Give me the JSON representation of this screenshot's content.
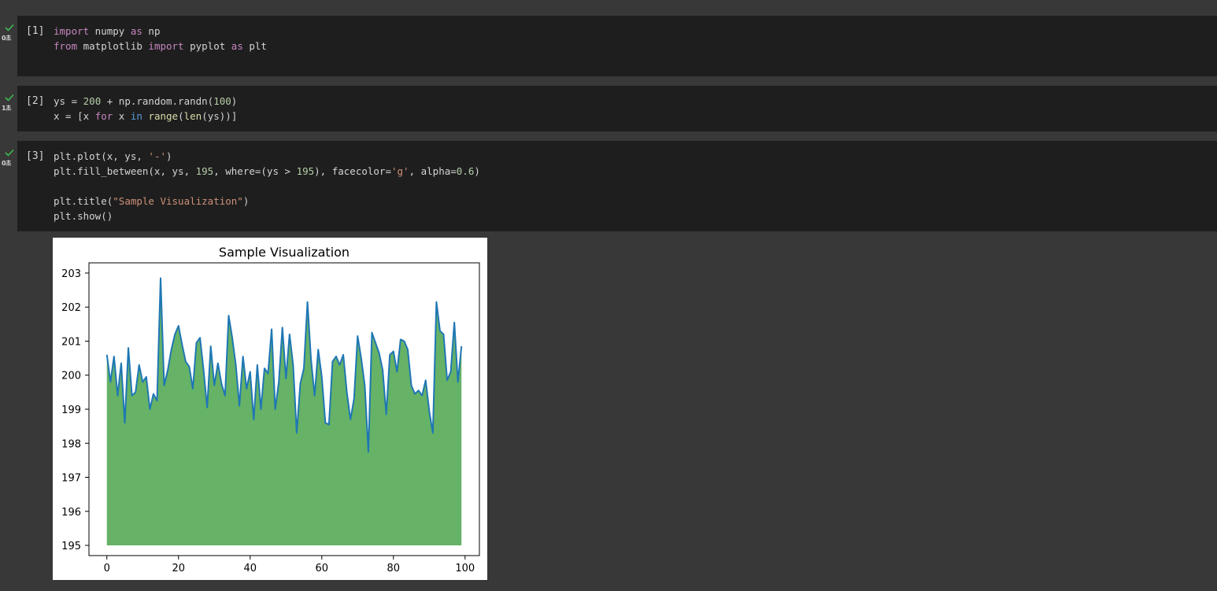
{
  "cells": [
    {
      "exec_label": "[1]",
      "status_time": "0초",
      "code_lines": [
        [
          {
            "t": "import",
            "c": "kw"
          },
          {
            "t": " numpy ",
            "c": ""
          },
          {
            "t": "as",
            "c": "kw"
          },
          {
            "t": " np",
            "c": ""
          }
        ],
        [
          {
            "t": "from",
            "c": "kw"
          },
          {
            "t": " matplotlib ",
            "c": ""
          },
          {
            "t": "import",
            "c": "kw"
          },
          {
            "t": " pyplot ",
            "c": ""
          },
          {
            "t": "as",
            "c": "kw"
          },
          {
            "t": " plt",
            "c": ""
          }
        ]
      ]
    },
    {
      "exec_label": "[2]",
      "status_time": "1초",
      "code_lines": [
        [
          {
            "t": "ys = ",
            "c": ""
          },
          {
            "t": "200",
            "c": "num"
          },
          {
            "t": " + np.random.randn(",
            "c": ""
          },
          {
            "t": "100",
            "c": "num"
          },
          {
            "t": ")",
            "c": ""
          }
        ],
        [
          {
            "t": "x = [x ",
            "c": ""
          },
          {
            "t": "for",
            "c": "kw"
          },
          {
            "t": " x ",
            "c": ""
          },
          {
            "t": "in",
            "c": "bi"
          },
          {
            "t": " ",
            "c": ""
          },
          {
            "t": "range",
            "c": "fn"
          },
          {
            "t": "(",
            "c": ""
          },
          {
            "t": "len",
            "c": "fn"
          },
          {
            "t": "(ys))]",
            "c": ""
          }
        ]
      ]
    },
    {
      "exec_label": "[3]",
      "status_time": "0초",
      "code_lines": [
        [
          {
            "t": "plt.plot(x, ys, ",
            "c": ""
          },
          {
            "t": "'-'",
            "c": "str"
          },
          {
            "t": ")",
            "c": ""
          }
        ],
        [
          {
            "t": "plt.fill_between(x, ys, ",
            "c": ""
          },
          {
            "t": "195",
            "c": "num"
          },
          {
            "t": ", where=(ys > ",
            "c": ""
          },
          {
            "t": "195",
            "c": "num"
          },
          {
            "t": "), facecolor=",
            "c": ""
          },
          {
            "t": "'g'",
            "c": "str"
          },
          {
            "t": ", alpha=",
            "c": ""
          },
          {
            "t": "0.6",
            "c": "num"
          },
          {
            "t": ")",
            "c": ""
          }
        ],
        [],
        [
          {
            "t": "plt.title(",
            "c": ""
          },
          {
            "t": "\"Sample Visualization\"",
            "c": "str"
          },
          {
            "t": ")",
            "c": ""
          }
        ],
        [
          {
            "t": "plt.show()",
            "c": ""
          }
        ]
      ]
    }
  ],
  "colors": {
    "line": "#1f77b4",
    "fill": "#66b266",
    "check": "#3fb950"
  },
  "chart_data": {
    "type": "area",
    "title": "Sample Visualization",
    "xlabel": "",
    "ylabel": "",
    "xlim": [
      -5,
      104
    ],
    "ylim": [
      194.7,
      203.3
    ],
    "fill_baseline": 195,
    "x_ticks": [
      0,
      20,
      40,
      60,
      80,
      100
    ],
    "y_ticks": [
      195,
      196,
      197,
      198,
      199,
      200,
      201,
      202,
      203
    ],
    "x": [
      0,
      1,
      2,
      3,
      4,
      5,
      6,
      7,
      8,
      9,
      10,
      11,
      12,
      13,
      14,
      15,
      16,
      17,
      18,
      19,
      20,
      21,
      22,
      23,
      24,
      25,
      26,
      27,
      28,
      29,
      30,
      31,
      32,
      33,
      34,
      35,
      36,
      37,
      38,
      39,
      40,
      41,
      42,
      43,
      44,
      45,
      46,
      47,
      48,
      49,
      50,
      51,
      52,
      53,
      54,
      55,
      56,
      57,
      58,
      59,
      60,
      61,
      62,
      63,
      64,
      65,
      66,
      67,
      68,
      69,
      70,
      71,
      72,
      73,
      74,
      75,
      76,
      77,
      78,
      79,
      80,
      81,
      82,
      83,
      84,
      85,
      86,
      87,
      88,
      89,
      90,
      91,
      92,
      93,
      94,
      95,
      96,
      97,
      98,
      99
    ],
    "series": [
      {
        "values": [
          200.6,
          199.8,
          200.55,
          199.4,
          200.35,
          198.6,
          200.8,
          199.4,
          199.5,
          200.3,
          199.8,
          199.95,
          199.0,
          199.45,
          199.25,
          202.85,
          199.7,
          200.15,
          200.75,
          201.2,
          201.45,
          200.9,
          200.4,
          200.25,
          199.6,
          200.95,
          201.1,
          200.15,
          199.05,
          200.85,
          199.7,
          200.35,
          199.75,
          199.4,
          201.75,
          201.1,
          200.3,
          199.1,
          200.55,
          199.6,
          200.1,
          198.7,
          200.3,
          199.0,
          200.2,
          200.05,
          201.35,
          199.0,
          199.8,
          201.4,
          199.9,
          201.2,
          200.3,
          198.3,
          199.75,
          200.2,
          202.15,
          200.45,
          199.4,
          200.75,
          199.95,
          198.6,
          198.55,
          200.4,
          200.55,
          200.3,
          200.6,
          199.5,
          198.7,
          199.3,
          201.15,
          200.5,
          199.7,
          197.75,
          201.25,
          200.95,
          200.65,
          200.15,
          198.85,
          200.6,
          200.7,
          200.1,
          201.05,
          201.0,
          200.75,
          199.7,
          199.45,
          199.55,
          199.4,
          199.85,
          198.95,
          198.3,
          202.15,
          201.3,
          201.2,
          199.85,
          200.1,
          201.55,
          199.8,
          200.85
        ]
      }
    ]
  }
}
